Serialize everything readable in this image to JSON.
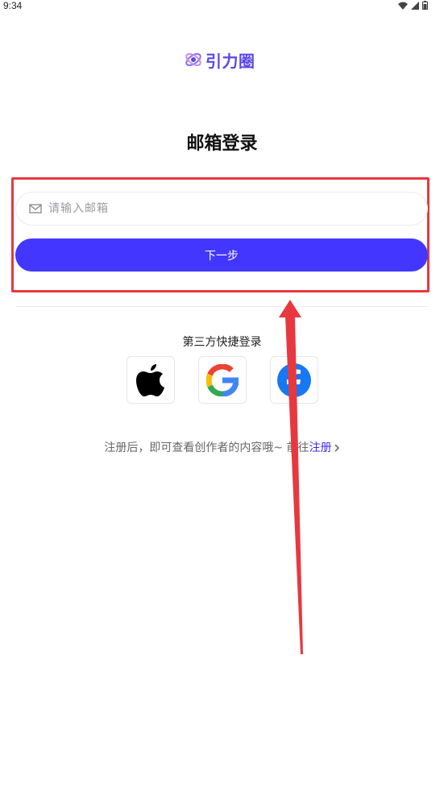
{
  "status_bar": {
    "time": "9:34",
    "icons": [
      "wifi-icon",
      "signal-icon",
      "battery-icon"
    ]
  },
  "logo": {
    "text": "引力圈",
    "icon": "orbit-logo-icon",
    "color": "#5a47e8"
  },
  "page": {
    "title": "邮箱登录"
  },
  "email_field": {
    "placeholder": "请输入邮箱",
    "value": "",
    "icon": "mail-icon"
  },
  "next_button": {
    "label": "下一步",
    "color": "#4337ff"
  },
  "third_party": {
    "label": "第三方快捷登录",
    "providers": [
      {
        "name": "apple",
        "icon": "apple-icon"
      },
      {
        "name": "google",
        "icon": "google-icon"
      },
      {
        "name": "facebook",
        "icon": "facebook-icon"
      }
    ]
  },
  "register": {
    "prompt": "注册后，即可查看创作者的内容哦~ 前往",
    "link_label": "注册"
  },
  "annotation": {
    "box_color": "#e8383f",
    "arrow_color": "#e8383f"
  }
}
